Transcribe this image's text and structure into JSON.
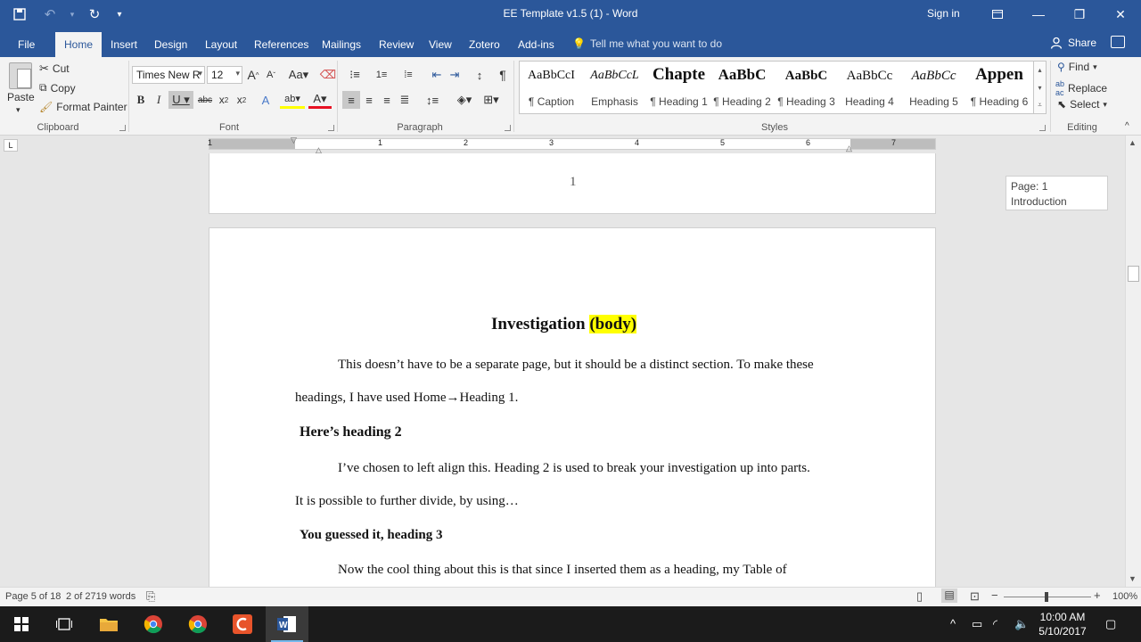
{
  "window": {
    "title": "EE Template v1.5 (1)  -  Word",
    "sign_in": "Sign in"
  },
  "tabs": [
    "File",
    "Home",
    "Insert",
    "Design",
    "Layout",
    "References",
    "Mailings",
    "Review",
    "View",
    "Zotero",
    "Add-ins"
  ],
  "tell_me": "Tell me what you want to do",
  "share": "Share",
  "clipboard": {
    "paste": "Paste",
    "cut": "Cut",
    "copy": "Copy",
    "format_painter": "Format Painter",
    "label": "Clipboard"
  },
  "font": {
    "family": "Times New R",
    "size": "12",
    "label": "Font"
  },
  "paragraph": {
    "label": "Paragraph"
  },
  "styles": {
    "label": "Styles",
    "items": [
      {
        "sample": "AaBbCcI",
        "name": "¶ Caption"
      },
      {
        "sample": "AaBbCcL",
        "name": "Emphasis"
      },
      {
        "sample": "Chapte",
        "name": "¶ Heading 1"
      },
      {
        "sample": "AaBbC",
        "name": "¶ Heading 2"
      },
      {
        "sample": "AaBbC",
        "name": "¶ Heading 3"
      },
      {
        "sample": "AaBbCc",
        "name": "Heading 4"
      },
      {
        "sample": "AaBbCc",
        "name": "Heading 5"
      },
      {
        "sample": "Appen",
        "name": "¶ Heading 6"
      }
    ]
  },
  "editing": {
    "find": "Find",
    "replace": "Replace",
    "select": "Select",
    "label": "Editing"
  },
  "ruler_numbers": [
    "1",
    "1",
    "2",
    "3",
    "4",
    "5",
    "6",
    "7"
  ],
  "document": {
    "page_number": "1",
    "heading1": "Investigation",
    "heading1_highlight": "(body)",
    "para1_line1": "This doesn’t have to be a separate page, but it should be a distinct section.  To make these",
    "para1_line2": "headings, I have used Home→Heading 1.",
    "heading2": "Here’s heading 2",
    "para2_line1": "I’ve chosen to left align this.  Heading 2 is used to break your investigation up into parts.",
    "para2_line2": "It is possible to further divide, by using…",
    "heading3": "You guessed it, heading 3",
    "para3_line1": "Now the cool thing about this is that since I inserted them as a heading, my Table of"
  },
  "page_tooltip": {
    "line1": "Page: 1",
    "line2": "Introduction"
  },
  "status": {
    "page": "Page 5 of 18",
    "words": "2 of 2719 words",
    "zoom": "100%"
  },
  "taskbar": {
    "time": "10:00 AM",
    "date": "5/10/2017"
  }
}
